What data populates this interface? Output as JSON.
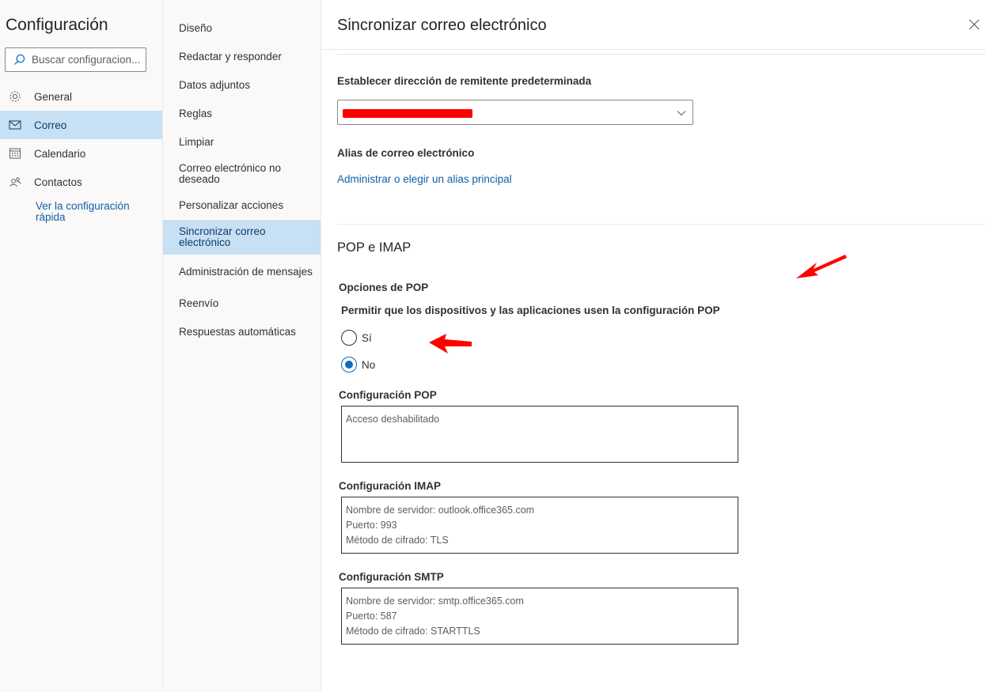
{
  "settings": {
    "title": "Configuración",
    "search_placeholder": "Buscar configuracion...",
    "nav": [
      {
        "label": "General",
        "icon": "gear-icon"
      },
      {
        "label": "Correo",
        "icon": "mail-icon"
      },
      {
        "label": "Calendario",
        "icon": "calendar-icon"
      },
      {
        "label": "Contactos",
        "icon": "people-icon"
      }
    ],
    "quick_link": "Ver la configuración rápida"
  },
  "submenu": [
    "Diseño",
    "Redactar y responder",
    "Datos adjuntos",
    "Reglas",
    "Limpiar",
    "Correo electrónico no deseado",
    "Personalizar acciones",
    "Sincronizar correo electrónico",
    "Administración de mensajes",
    "Reenvío",
    "Respuestas automáticas"
  ],
  "main": {
    "title": "Sincronizar correo electrónico",
    "default_sender_label": "Establecer dirección de remitente predeterminada",
    "alias_label": "Alias de correo electrónico",
    "alias_link": "Administrar o elegir un alias principal",
    "pop_imap_heading": "POP e IMAP",
    "pop_options_label": "Opciones de POP",
    "pop_question": "Permitir que los dispositivos y las aplicaciones usen la configuración POP",
    "radio_yes": "Sí",
    "radio_no": "No",
    "pop_config_label": "Configuración POP",
    "pop_config_lines": [
      "Acceso deshabilitado"
    ],
    "imap_config_label": "Configuración IMAP",
    "imap_config_lines": [
      "Nombre de servidor: outlook.office365.com",
      "Puerto: 993",
      "Método de cifrado: TLS"
    ],
    "smtp_config_label": "Configuración SMTP",
    "smtp_config_lines": [
      "Nombre de servidor: smtp.office365.com",
      "Puerto: 587",
      "Método de cifrado: STARTTLS"
    ]
  },
  "colors": {
    "accent": "#0f6cbd",
    "selected_bg": "#c7e0f4",
    "annotation_arrow": "#ff0000",
    "redaction": "#ff0000"
  }
}
